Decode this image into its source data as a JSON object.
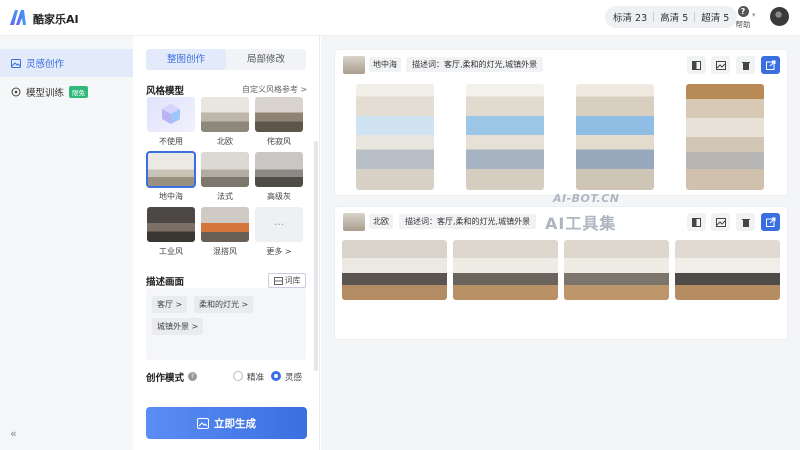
{
  "header": {
    "brand": "酷家乐AI",
    "quota": [
      {
        "label": "标清",
        "value": "23"
      },
      {
        "label": "高清",
        "value": "5"
      },
      {
        "label": "超清",
        "value": "5"
      }
    ],
    "help_label": "帮助",
    "help_icon": "question-icon"
  },
  "nav": {
    "items": [
      {
        "label": "灵感创作",
        "icon": "image-icon"
      },
      {
        "label": "模型训练",
        "icon": "model-icon",
        "badge": "限免"
      }
    ],
    "collapse_glyph": "«"
  },
  "panel": {
    "tabs": [
      "整图创作",
      "局部修改"
    ],
    "style_section": {
      "title": "风格模型",
      "custom_link": "自定义风格参考 >",
      "styles": [
        "不使用",
        "北欧",
        "侘寂风",
        "地中海",
        "法式",
        "高级灰",
        "工业风",
        "混搭风",
        "更多 >"
      ],
      "selected": "地中海"
    },
    "describe_section": {
      "title": "描述画面",
      "lexicon_label": "词库",
      "chips": [
        "客厅 >",
        "柔和的灯光 >",
        "城镇外景 >"
      ]
    },
    "mode_section": {
      "title": "创作模式",
      "options": [
        "精准",
        "灵感"
      ],
      "selected": "灵感"
    },
    "generate_label": "立即生成"
  },
  "results": [
    {
      "style": "地中海",
      "description": "描述词：客厅,柔和的灯光,城镇外景"
    },
    {
      "style": "北欧",
      "description": "描述词：客厅,柔和的灯光,城镇外景"
    }
  ],
  "watermark": {
    "line1": "AI-BOT.CN",
    "line2": "AI工具集"
  },
  "colors": {
    "accent": "#3a6fe0",
    "badge": "#2fba7c"
  }
}
